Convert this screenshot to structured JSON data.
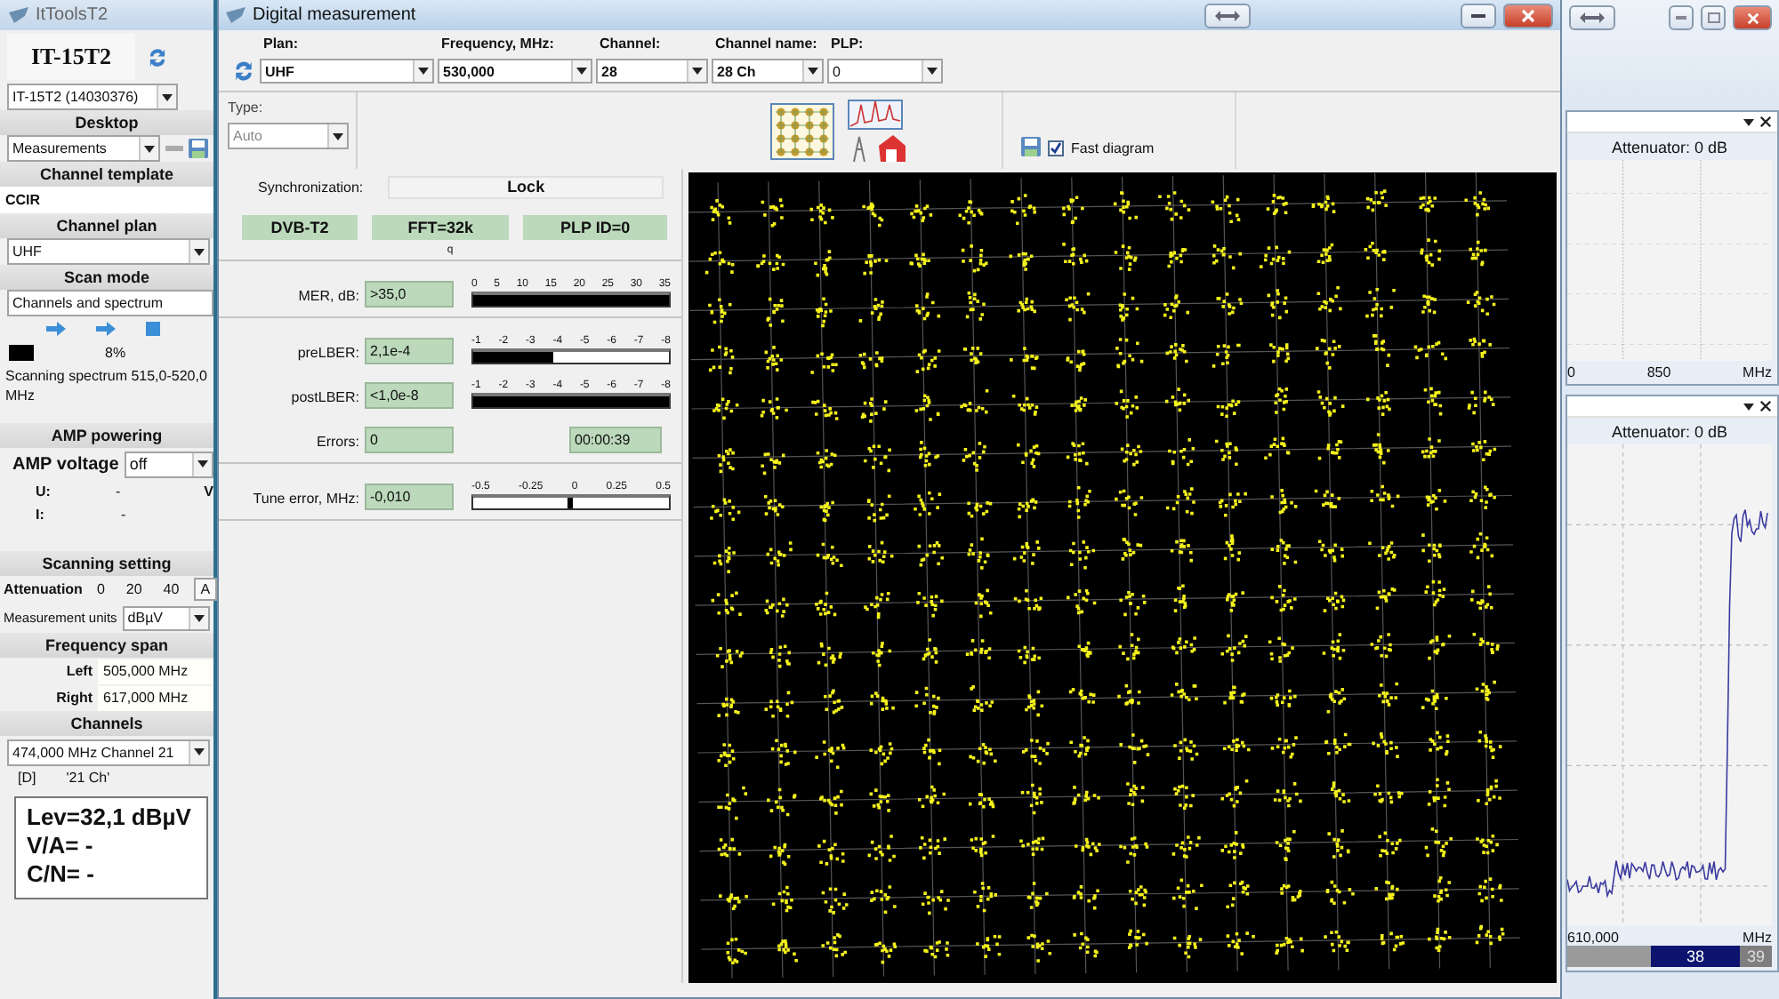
{
  "app_window": {
    "title": "ItToolsT2"
  },
  "device": {
    "name": "IT-15T2",
    "selector": "IT-15T2 (14030376)"
  },
  "desktop": {
    "header": "Desktop",
    "value": "Measurements"
  },
  "channel_template": {
    "header": "Channel template",
    "value": "CCIR"
  },
  "channel_plan": {
    "header": "Channel plan",
    "value": "UHF"
  },
  "scan_mode": {
    "header": "Scan mode",
    "value": "Channels and spectrum",
    "progress": {
      "reading": "8%"
    },
    "status": "Scanning spectrum 515,0-520,0 MHz"
  },
  "amp": {
    "header": "AMP powering",
    "voltage_label": "AMP voltage",
    "voltage": "off",
    "rows": [
      {
        "label": "U:",
        "value": "-",
        "unit": "V"
      },
      {
        "label": "I:",
        "value": "-"
      }
    ]
  },
  "scanning": {
    "header": "Scanning setting",
    "attenuation_label": "Attenuation",
    "attenuation_options": [
      {
        "label": "0",
        "selected": false
      },
      {
        "label": "20",
        "selected": false
      },
      {
        "label": "40",
        "selected": false
      },
      {
        "label": "A",
        "selected": true
      }
    ],
    "units_label": "Measurement units",
    "units": "dBµV"
  },
  "frequency_span": {
    "header": "Frequency span",
    "rows": [
      {
        "label": "Left",
        "value": "505,000 MHz"
      },
      {
        "label": "Right",
        "value": "617,000 MHz"
      }
    ]
  },
  "channels": {
    "header": "Channels",
    "value": "474,000 MHz  Channel 21",
    "flag": "[D]",
    "name": "'21 Ch'",
    "readings": [
      "Lev=32,1 dBµV",
      "V/A= -",
      "C/N= -"
    ]
  },
  "dialog": {
    "title": "Digital measurement",
    "fields": [
      {
        "label": "Plan:",
        "value": "UHF"
      },
      {
        "label": "Frequency,  MHz:",
        "value": "530,000"
      },
      {
        "label": "Channel:",
        "value": "28"
      },
      {
        "label": "Channel name:",
        "value": "28 Ch"
      },
      {
        "label": "PLP:",
        "value": "0"
      }
    ],
    "type": {
      "label": "Type:",
      "value": "Auto",
      "disabled": true
    },
    "fast_diagram": {
      "label": "Fast diagram",
      "checked": true
    },
    "sync": {
      "label": "Synchronization:",
      "value": "Lock"
    },
    "badges": [
      "DVB-T2",
      "FFT=32k",
      "PLP ID=0"
    ],
    "note": "q",
    "groups": [
      [
        {
          "kind": "meter",
          "label": "MER, dB:",
          "value": ">35,0",
          "scale": [
            "0",
            "5",
            "10",
            "15",
            "20",
            "25",
            "30",
            "35"
          ],
          "level": 1
        }
      ],
      [
        {
          "kind": "meter",
          "label": "preLBER:",
          "value": "2,1e-4",
          "scale": [
            "-1",
            "-2",
            "-3",
            "-4",
            "-5",
            "-6",
            "-7",
            "-8"
          ],
          "level": 0.41
        },
        {
          "kind": "meter",
          "label": "postLBER:",
          "value": "<1,0e-8",
          "scale": [
            "-1",
            "-2",
            "-3",
            "-4",
            "-5",
            "-6",
            "-7",
            "-8"
          ],
          "level": 1
        },
        {
          "kind": "timer",
          "label": "Errors:",
          "value": "0",
          "timer": "00:00:39"
        }
      ],
      [
        {
          "kind": "marker",
          "label": "Tune error, MHz:",
          "value": "-0,010",
          "scale": [
            "-0.5",
            "-0.25",
            "0",
            "0.25",
            "0.5"
          ],
          "level": 0.49
        }
      ]
    ]
  },
  "spectrum_panels": [
    {
      "attenuator": "Attenuator: 0 dB",
      "x_labels": [
        "0",
        "850",
        "MHz"
      ]
    },
    {
      "attenuator": "Attenuator: 0 dB",
      "x_labels": [
        "610,000",
        "MHz"
      ],
      "channels": [
        {
          "label": "38",
          "selected": true
        },
        {
          "label": "39",
          "selected": false
        }
      ]
    }
  ]
}
